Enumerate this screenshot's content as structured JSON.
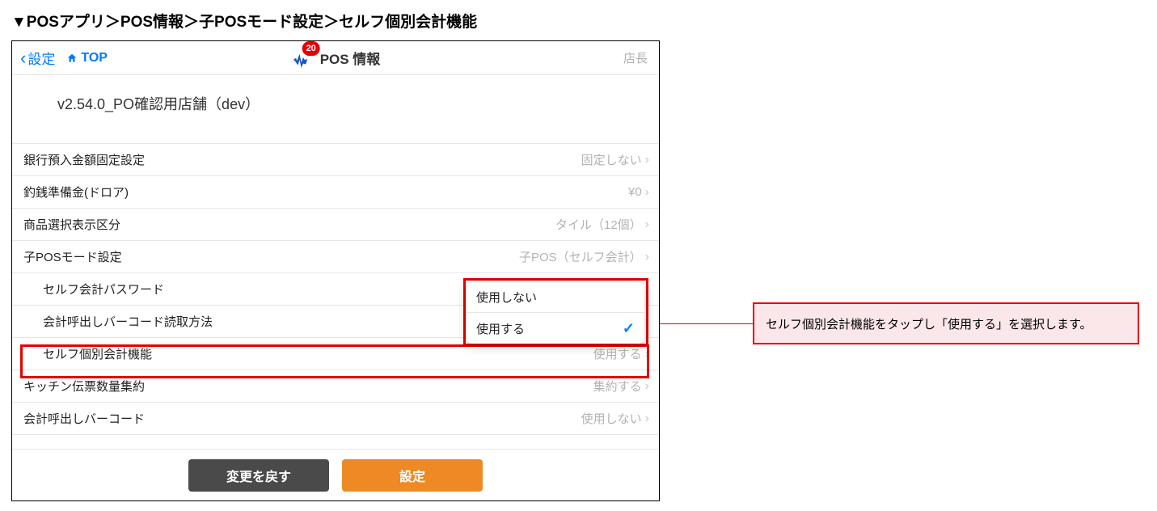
{
  "pageTitle": "▼POSアプリ＞POS情報＞子POSモード設定＞セルフ個別会計機能",
  "nav": {
    "backLabel": "設定",
    "topLabel": "TOP",
    "title": "POS 情報",
    "badge": "20",
    "userLabel": "店長"
  },
  "storeName": "v2.54.0_PO確認用店舗（dev）",
  "rows": {
    "bankDeposit": {
      "label": "銀行預入金額固定設定",
      "value": "固定しない"
    },
    "changeFund": {
      "label": "釣銭準備金(ドロア)",
      "value": "¥0"
    },
    "displayType": {
      "label": "商品選択表示区分",
      "value": "タイル（12個）"
    },
    "childPos": {
      "label": "子POSモード設定",
      "value": "子POS（セルフ会計）"
    },
    "selfPwd": {
      "label": "セルフ会計パスワード",
      "value": ""
    },
    "barcodeRead": {
      "label": "会計呼出しバーコード読取方法",
      "value": ""
    },
    "selfIndiv": {
      "label": "セルフ個別会計機能",
      "value": "使用する"
    },
    "kitchen": {
      "label": "キッチン伝票数量集約",
      "value": "集約する"
    },
    "callBarcode": {
      "label": "会計呼出しバーコード",
      "value": "使用しない"
    }
  },
  "popover": {
    "optionA": "使用しない",
    "optionB": "使用する"
  },
  "footer": {
    "revert": "変更を戻す",
    "apply": "設定"
  },
  "callout": "セルフ個別会計機能をタップし「使用する」を選択します。"
}
